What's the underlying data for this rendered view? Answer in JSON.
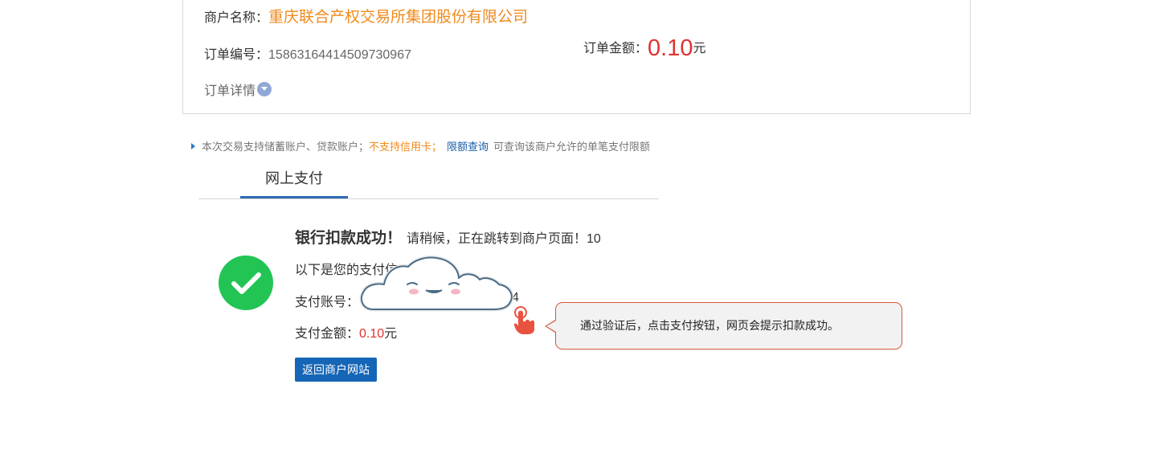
{
  "order": {
    "merchant_label": "商户名称：",
    "merchant_name": "重庆联合产权交易所集团股份有限公司",
    "order_no_label": "订单编号：",
    "order_no": "15863164414509730967",
    "amount_label": "订单金额：",
    "amount": "0.10",
    "amount_unit": "元",
    "detail_link": "订单详情",
    "detail_icon": "chevron-down-circle-icon"
  },
  "notice": {
    "text1": "本次交易支持储蓄账户、贷款账户；",
    "warning": "不支持信用卡；",
    "limit_link": "限额查询",
    "text2": "可查询该商户允许的单笔支付限额"
  },
  "tabs": [
    {
      "label": "网上支付",
      "active": true
    }
  ],
  "result": {
    "status_icon": "check-circle-icon",
    "title": "银行扣款成功！",
    "subtitle": "请稍候，正在跳转到商户页面！10",
    "info_intro": "以下是您的支付信",
    "account_label": "支付账号：",
    "account_tail": "4",
    "paid_label": "支付金额：",
    "paid_amount": "0.10",
    "paid_unit": "元",
    "back_button": "返回商户网站"
  },
  "overlay": {
    "sticker": "cloud-mascot-icon",
    "pointer": "hand-pointer-icon",
    "callout_text": "通过验证后，点击支付按钮，网页会提示扣款成功。"
  },
  "colors": {
    "accent_blue": "#1566b6",
    "merchant_orange": "#f08a1c",
    "amount_red": "#e03131",
    "success_green": "#22c554",
    "callout_border": "#d65a3a"
  }
}
